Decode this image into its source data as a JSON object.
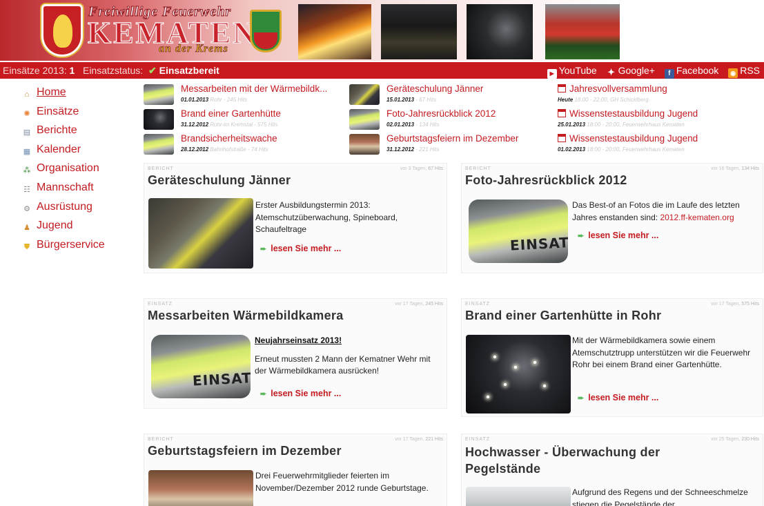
{
  "header": {
    "brand_top": "Freiwillige Feuerwehr",
    "brand_main": "KEMATEN",
    "brand_sub": "an der Krems"
  },
  "statusbar": {
    "einsaetze_label": "Einsätze 2013:",
    "einsaetze_count": "1",
    "status_label": "Einsatzstatus:",
    "status_value": "Einsatzbereit",
    "links": [
      {
        "label": "YouTube",
        "icon": "youtube-icon"
      },
      {
        "label": "Google+",
        "icon": "google-plus-icon"
      },
      {
        "label": "Facebook",
        "icon": "facebook-icon"
      },
      {
        "label": "RSS",
        "icon": "rss-icon"
      }
    ]
  },
  "sidebar": {
    "items": [
      {
        "label": "Home",
        "icon": "home-icon"
      },
      {
        "label": "Einsätze",
        "icon": "flame-icon"
      },
      {
        "label": "Berichte",
        "icon": "document-icon"
      },
      {
        "label": "Kalender",
        "icon": "calendar-icon"
      },
      {
        "label": "Organisation",
        "icon": "org-chart-icon"
      },
      {
        "label": "Mannschaft",
        "icon": "team-icon"
      },
      {
        "label": "Ausrüstung",
        "icon": "gear-icon"
      },
      {
        "label": "Jugend",
        "icon": "user-icon"
      },
      {
        "label": "Bürgerservice",
        "icon": "shield-icon"
      }
    ]
  },
  "strip": {
    "col1": [
      {
        "title": "Messarbeiten mit der Wärmebildk...",
        "date": "01.01.2013",
        "meta": "Rohr - 245 Hits"
      },
      {
        "title": "Brand einer Gartenhütte",
        "date": "31.12.2012",
        "meta": "Rohr im Kremstal - 575 Hits"
      },
      {
        "title": "Brandsicherheitswache",
        "date": "28.12.2012",
        "meta": "Bahnhofstraße - 74 Hits"
      }
    ],
    "col2": [
      {
        "title": "Geräteschulung Jänner",
        "date": "15.01.2013",
        "meta": "- 67 Hits"
      },
      {
        "title": "Foto-Jahresrückblick 2012",
        "date": "02.01.2013",
        "meta": "- 134 Hits"
      },
      {
        "title": "Geburtstagsfeiern im Dezember",
        "date": "31.12.2012",
        "meta": "- 221 Hits"
      }
    ],
    "col3": [
      {
        "title": "Jahresvollversammlung",
        "date": "Heute",
        "meta": "18:00 - 22:00, GH Schicklberg"
      },
      {
        "title": "Wissenstestausbildung Jugend",
        "date": "25.01.2013",
        "meta": "18:00 - 20:00, Feuerwehrhaus Kematen"
      },
      {
        "title": "Wissenstestausbildung Jugend",
        "date": "01.02.2013",
        "meta": "18:00 - 20:00, Feuerwehrhaus Kematen"
      }
    ]
  },
  "cards": [
    {
      "category": "BERICHT",
      "when": "vor 3 Tagen,",
      "hits": "67 Hits",
      "title": "Geräteschulung Jänner",
      "text": "Erster Ausbildungstermin 2013: Atemschutzüberwachung, Spineboard, Schaufeltrage",
      "more": "lesen Sie mehr ..."
    },
    {
      "category": "BERICHT",
      "when": "vor 16 Tagen,",
      "hits": "134 Hits",
      "title": "Foto-Jahresrückblick 2012",
      "text": "Das Best-of an Fotos die im Laufe des letzten Jahres enstanden sind:",
      "link": "2012.ff-kematen.org",
      "more": "lesen Sie mehr ..."
    },
    {
      "category": "EINSATZ",
      "when": "vor 17 Tagen,",
      "hits": "245 Hits",
      "title": "Messarbeiten Wärmebildkamera",
      "headline": "Neujahrseinsatz 2013!",
      "text": "Erneut mussten 2 Mann der Kematner Wehr mit der Wärmebildkamera ausrücken!",
      "more": "lesen Sie mehr ..."
    },
    {
      "category": "EINSATZ",
      "when": "vor 17 Tagen,",
      "hits": "575 Hits",
      "title": "Brand einer Gartenhütte in Rohr",
      "text": "Mit der Wärmebildkamera sowie einem Atemschutztrupp unterstützen wir die Feuerwehr Rohr bei einem Brand einer Gartenhütte.",
      "more": "lesen Sie mehr ..."
    },
    {
      "category": "BERICHT",
      "when": "vor 17 Tagen,",
      "hits": "221 Hits",
      "title": "Geburtstagsfeiern im Dezember",
      "text": "Drei Feuerwehrmitglieder feierten im November/Dezember 2012 runde Geburtstage."
    },
    {
      "category": "EINSATZ",
      "when": "vor 25 Tagen,",
      "hits": "230 Hits",
      "title_line1": "Hochwasser - Überwachung der",
      "title_line2": "Pegelstände",
      "text": "Aufgrund des Regens und der Schneeschmelze stiegen die Pegelstände der"
    }
  ],
  "vest_text": "EINSATZ"
}
